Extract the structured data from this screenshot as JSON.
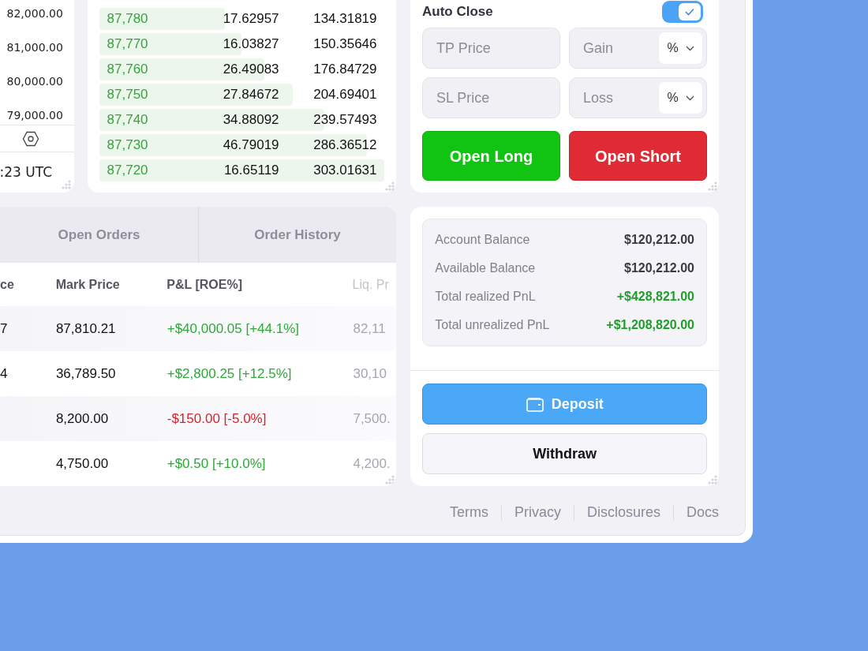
{
  "price_axis": {
    "labels": [
      "82,000.00",
      "81,000.00",
      "80,000.00",
      "79,000.00"
    ],
    "time": ":23 UTC"
  },
  "order_book": {
    "rows": [
      {
        "price": "87,780",
        "amount": "17.62957",
        "total": "134.31819",
        "level": 0.44
      },
      {
        "price": "87,770",
        "amount": "16.03827",
        "total": "150.35646",
        "level": 0.5
      },
      {
        "price": "87,760",
        "amount": "26.49083",
        "total": "176.84729",
        "level": 0.58
      },
      {
        "price": "87,750",
        "amount": "27.84672",
        "total": "204.69401",
        "level": 0.68
      },
      {
        "price": "87,740",
        "amount": "34.88092",
        "total": "239.57493",
        "level": 0.79
      },
      {
        "price": "87,730",
        "amount": "46.79019",
        "total": "286.36512",
        "level": 0.94
      },
      {
        "price": "87,720",
        "amount": "16.65119",
        "total": "303.01631",
        "level": 1.0
      }
    ]
  },
  "order_form": {
    "auto_close": {
      "label": "Auto Close",
      "checked": true
    },
    "fields": [
      {
        "placeholder": "TP Price",
        "unit_placeholder": "Gain",
        "unit": "%"
      },
      {
        "placeholder": "SL Price",
        "unit_placeholder": "Loss",
        "unit": "%"
      }
    ],
    "buttons": [
      {
        "label": "Open Long",
        "kind": "long"
      },
      {
        "label": "Open Short",
        "kind": "short"
      }
    ]
  },
  "positions": {
    "tabs": [
      {
        "label": "Open Orders",
        "selected": false
      },
      {
        "label": "Order History",
        "selected": false
      }
    ],
    "columns": [
      "ce",
      "Mark Price",
      "P&L [ROE%]",
      "Liq. Pr"
    ],
    "rows": [
      {
        "column_1": "7",
        "mark_price": "87,810.21",
        "pnl": "+$40,000.05 [+44.1%]",
        "positive": true,
        "liq": "82,11"
      },
      {
        "column_1": "4",
        "mark_price": "36,789.50",
        "pnl": "+$2,800.25 [+12.5%]",
        "positive": true,
        "liq": "30,10"
      },
      {
        "mark_price": "8,200.00",
        "pnl": "-$150.00 [-5.0%]",
        "positive": false,
        "liq": "7,500."
      },
      {
        "mark_price": "4,750.00",
        "pnl": "+$0.50 [+10.0%]",
        "positive": true,
        "liq": "4,200."
      }
    ]
  },
  "account": {
    "rows": [
      {
        "label": "Account Balance",
        "value": "$120,212.00",
        "kind": "plain"
      },
      {
        "label": "Available Balance",
        "value": "$120,212.00",
        "kind": "plain"
      },
      {
        "label": "Total realized PnL",
        "value": "+$428,821.00",
        "kind": "gain"
      },
      {
        "label": "Total unrealized PnL",
        "value": "+$1,208,820.00",
        "kind": "gain"
      }
    ],
    "deposit": "Deposit",
    "withdraw": "Withdraw"
  },
  "footer_links": [
    "Terms",
    "Privacy",
    "Disclosures",
    "Docs"
  ]
}
